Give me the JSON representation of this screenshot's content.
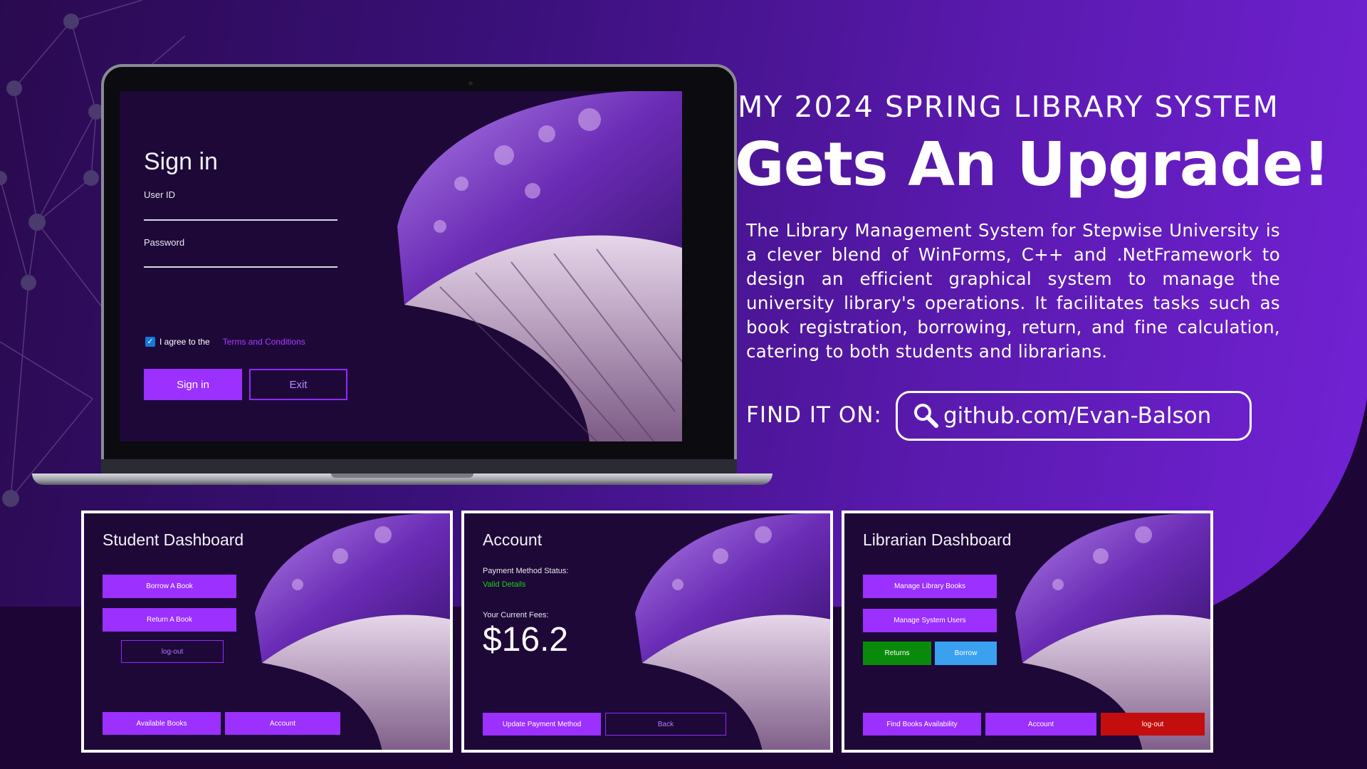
{
  "headline": {
    "pre": "MY 2024 SPRING LIBRARY SYSTEM",
    "main": "Gets An Upgrade!"
  },
  "description": "The Library Management System for Stepwise University is a clever blend of WinForms, C++ and .NetFramework to design an efficient graphical system to manage the university library's operations. It facilitates tasks such as book registration, borrowing, return, and fine calculation, catering to both students and librarians.",
  "find": {
    "label": "FIND IT ON:",
    "link": "github.com/Evan-Balson"
  },
  "signin": {
    "title": "Sign in",
    "user_id_label": "User ID",
    "password_label": "Password",
    "agree_text": "I agree to the",
    "terms_link": "Terms and Conditions",
    "signin_button": "Sign in",
    "exit_button": "Exit"
  },
  "student_dashboard": {
    "title": "Student Dashboard",
    "borrow": "Borrow A Book",
    "return": "Return A Book",
    "logout": "log-out",
    "available_books": "Available Books",
    "account": "Account"
  },
  "account": {
    "title": "Account",
    "payment_status_label": "Payment Method Status:",
    "payment_status_value": "Valid Details",
    "fees_label": "Your Current Fees:",
    "fees_value": "$16.2",
    "update_payment": "Update Payment Method",
    "back": "Back"
  },
  "librarian_dashboard": {
    "title": "Librarian Dashboard",
    "manage_books": "Manage Library Books",
    "manage_users": "Manage System Users",
    "returns": "Returns",
    "borrow": "Borrow",
    "find_books": "Find Books Availability",
    "account": "Account",
    "logout": "log-out"
  },
  "colors": {
    "accent_purple": "#9b30ff",
    "valid_green": "#19d119",
    "returns_green": "#0a8a0a",
    "borrow_blue": "#3aa0f0",
    "logout_red": "#c40d0d"
  }
}
